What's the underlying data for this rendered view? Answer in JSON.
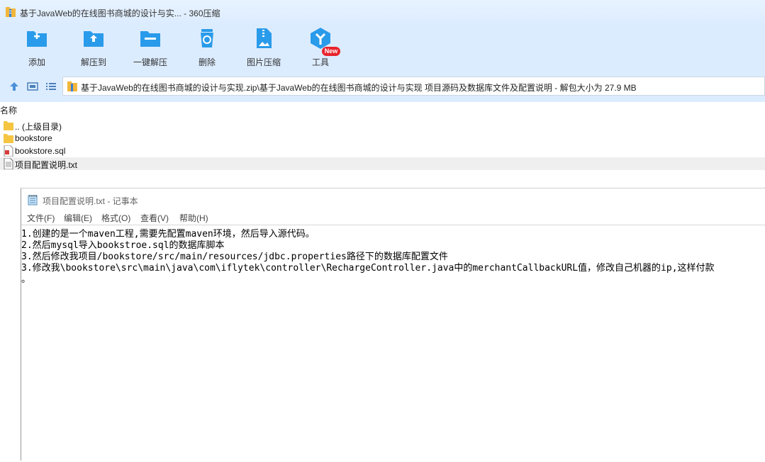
{
  "window": {
    "title": "基于JavaWeb的在线图书商城的设计与实... - 360压缩"
  },
  "toolbar": {
    "items": [
      {
        "label": "添加",
        "icon": "add-icon"
      },
      {
        "label": "解压到",
        "icon": "extract-to-icon"
      },
      {
        "label": "一键解压",
        "icon": "one-click-extract-icon"
      },
      {
        "label": "删除",
        "icon": "delete-icon"
      },
      {
        "label": "图片压缩",
        "icon": "image-compress-icon"
      },
      {
        "label": "工具",
        "icon": "tools-icon"
      }
    ],
    "new_badge": "New"
  },
  "address": {
    "path": "基于JavaWeb的在线图书商城的设计与实现.zip\\基于JavaWeb的在线图书商城的设计与实现 项目源码及数据库文件及配置说明 - 解包大小为 27.9 MB"
  },
  "filelist": {
    "column_name": "名称",
    "items": [
      {
        "name": ".. (上级目录)",
        "icon": "parent-folder-icon"
      },
      {
        "name": "bookstore",
        "icon": "folder-icon"
      },
      {
        "name": "bookstore.sql",
        "icon": "sql-file-icon"
      },
      {
        "name": "项目配置说明.txt",
        "icon": "text-file-icon",
        "selected": true
      }
    ]
  },
  "notepad": {
    "title": "项目配置说明.txt - 记事本",
    "menu": [
      "文件(F)",
      "编辑(E)",
      "格式(O)",
      "查看(V)",
      "帮助(H)"
    ],
    "lines": [
      "1.创建的是一个maven工程,需要先配置maven环境，然后导入源代码。",
      "2.然后mysql导入bookstroe.sql的数据库脚本",
      "3.然后修改我项目/bookstore/src/main/resources/jdbc.properties路径下的数据库配置文件",
      "3.修改我\\bookstore\\src\\main\\java\\com\\iflytek\\controller\\RechargeController.java中的merchantCallbackURL值，修改自己机器的ip,这样付款",
      "。"
    ]
  },
  "colors": {
    "accent": "#2a9bea",
    "toolbar_bg": "#dcecff",
    "badge": "#e8242d"
  }
}
